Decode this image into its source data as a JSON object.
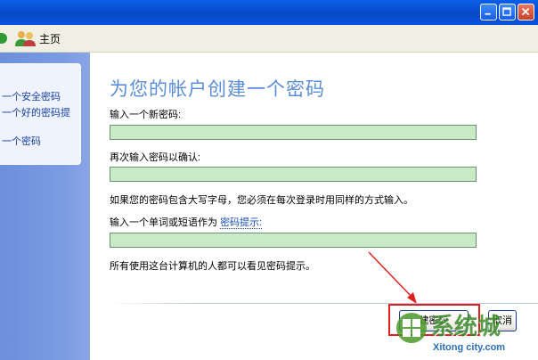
{
  "toolbar": {
    "home_label": "主页"
  },
  "sidebar": {
    "links": [
      "一个安全密码",
      "一个好的密码提",
      "一个密码"
    ]
  },
  "main": {
    "title": "为您的帐户创建一个密码",
    "new_password_label": "输入一个新密码:",
    "confirm_label": "再次输入密码以确认:",
    "case_note": "如果您的密码包含大写字母，您必须在每次登录时用同样的方式输入。",
    "hint_label_prefix": "输入一个单词或短语作为",
    "hint_link": "密码提示:",
    "hint_note": "所有使用这台计算机的人都可以看见密码提示。",
    "new_password_value": "",
    "confirm_value": "",
    "hint_value": ""
  },
  "buttons": {
    "create": "建密码",
    "cancel": "取消"
  },
  "watermark": {
    "site": "Xitong city.com",
    "brand": "系统城"
  },
  "colors": {
    "titlebar": "#0a5fe8",
    "field_bg": "#c8ebc6",
    "highlight": "#e02020",
    "title_text": "#5a8ed8"
  }
}
